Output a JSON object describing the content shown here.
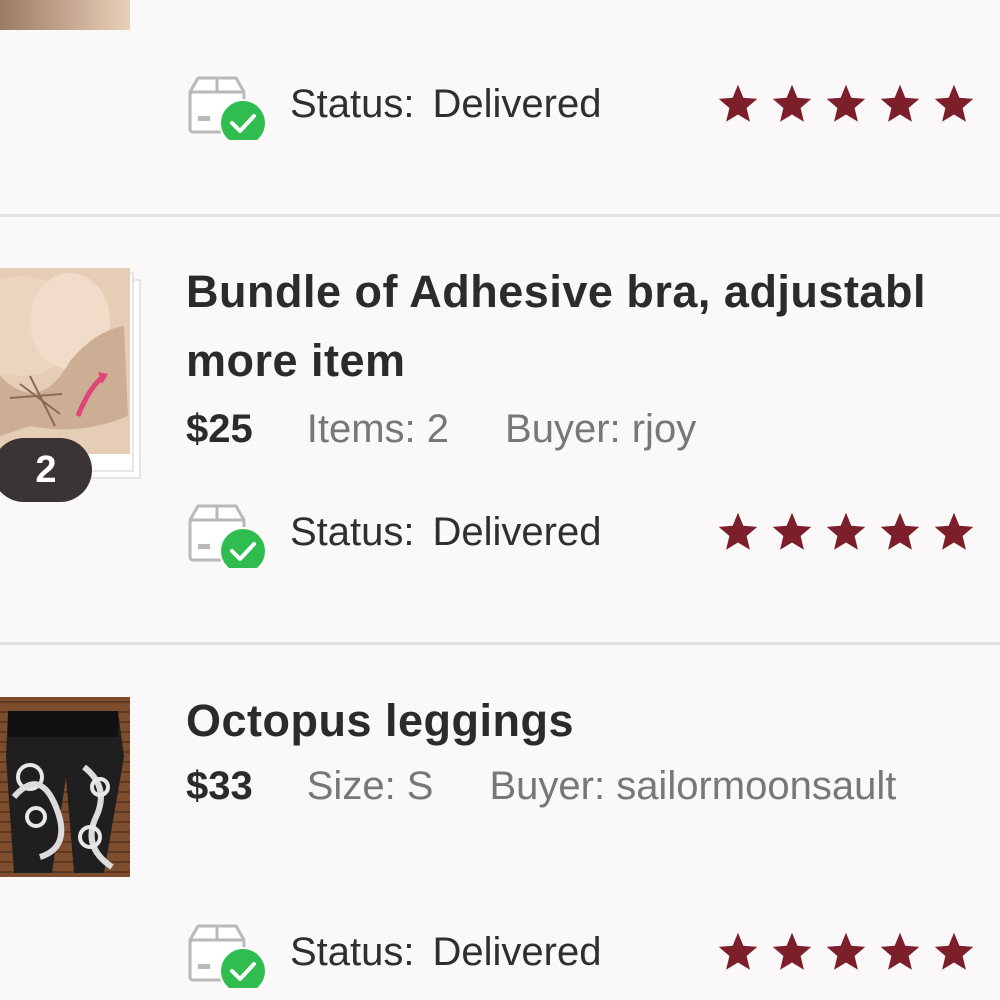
{
  "orders": [
    {
      "status_label": "Status:",
      "status_value": "Delivered",
      "rating": 5
    },
    {
      "title_line1": "Bundle of Adhesive bra, adjustabl",
      "title_line2": "more item",
      "price": "$25",
      "detail": "Items: 2",
      "buyer": "Buyer: rjoy",
      "bundle_count": "2",
      "status_label": "Status:",
      "status_value": "Delivered",
      "rating": 5
    },
    {
      "title_line1": "Octopus leggings",
      "price": "$33",
      "detail": "Size: S",
      "buyer": "Buyer: sailormoonsault",
      "status_label": "Status:",
      "status_value": "Delivered",
      "rating": 5
    }
  ],
  "icons": {
    "status": "delivered-box-icon",
    "rating": "star-icon"
  },
  "colors": {
    "star": "#7d1f2b",
    "check": "#2ebd4e",
    "divider": "#e3e0e1",
    "badge": "#3a3534"
  }
}
